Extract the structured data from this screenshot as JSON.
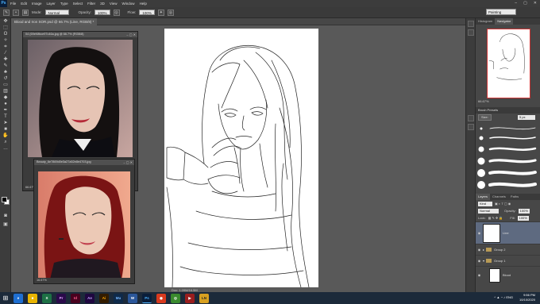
{
  "app": {
    "logo": "Ps",
    "menu": [
      "File",
      "Edit",
      "Image",
      "Layer",
      "Type",
      "Select",
      "Filter",
      "3D",
      "View",
      "Window",
      "Help"
    ],
    "window_controls": [
      "–",
      "▢",
      "✕"
    ]
  },
  "options": {
    "mode_label": "Mode:",
    "mode_value": "Normal",
    "opacity_label": "Opacity:",
    "opacity_value": "100%",
    "flow_label": "Flow:",
    "flow_value": "100%",
    "workspace": "Painting"
  },
  "document": {
    "tab_title": "Blood and Iron SOR.psd @ 66.7% (Line, RGB/8) *"
  },
  "ref_windows": {
    "top": {
      "title": "04 (69ef4fbce97c46a.jpg @ 66.7% (RGB/8)",
      "zoom": "66.67%"
    },
    "bottom": {
      "title": "Beauty_6e7869d0e3a27a52e8e4703.jpg",
      "status": "16.67%"
    }
  },
  "status_bar": {
    "doc_info": "Doc: 1.09M/16.5M"
  },
  "panels": {
    "navigator_tabs": [
      "Histogram",
      "Navigator"
    ],
    "navigator_zoom": "66.67%",
    "brush_presets_title": "Brush Presets",
    "brush_size_label": "Size:",
    "brush_size_value": "5 px",
    "layers_tabs": [
      "Layers",
      "Channels",
      "Paths"
    ],
    "kind_label": "Kind",
    "blend_mode": "Normal",
    "opacity_label": "Opacity:",
    "opacity_value": "100%",
    "lock_label": "Lock:",
    "fill_label": "Fill:",
    "fill_value": "100%",
    "layers": [
      {
        "name": "Line",
        "type": "layer",
        "selected": true
      },
      {
        "name": "Group 2",
        "type": "group",
        "selected": false
      },
      {
        "name": "Group 1",
        "type": "group",
        "selected": false
      },
      {
        "name": "Blood",
        "type": "layer",
        "selected": false
      }
    ]
  },
  "taskbar": {
    "apps": [
      {
        "label": "e",
        "color": "#1f6fd1",
        "icon": "ie-icon"
      },
      {
        "label": "■",
        "color": "#e8b400",
        "icon": "folder-icon"
      },
      {
        "label": "X",
        "color": "#1e7145",
        "icon": "excel-icon"
      },
      {
        "label": "Pr",
        "color": "#2a0a4a",
        "icon": "premiere-icon"
      },
      {
        "label": "Id",
        "color": "#49021f",
        "icon": "indesign-icon"
      },
      {
        "label": "Ae",
        "color": "#1f0740",
        "icon": "aftereffects-icon"
      },
      {
        "label": "Ai",
        "color": "#331c00",
        "icon": "illustrator-icon"
      },
      {
        "label": "Mu",
        "color": "#0f2a4a",
        "icon": "muse-icon"
      },
      {
        "label": "W",
        "color": "#2b579a",
        "icon": "word-icon"
      },
      {
        "label": "Ps",
        "color": "#0a1e3a",
        "icon": "photoshop-icon"
      },
      {
        "label": "◉",
        "color": "#d93a1e",
        "icon": "firefox-icon"
      },
      {
        "label": "◎",
        "color": "#3a8a2e",
        "icon": "chrome-icon"
      },
      {
        "label": "▶",
        "color": "#9a1e1e",
        "icon": "media-icon"
      },
      {
        "label": "LN",
        "color": "#d8a020",
        "icon": "app-ln-icon"
      }
    ],
    "lang": "ENG",
    "time": "9:56 PM",
    "date": "10/10/2020"
  }
}
